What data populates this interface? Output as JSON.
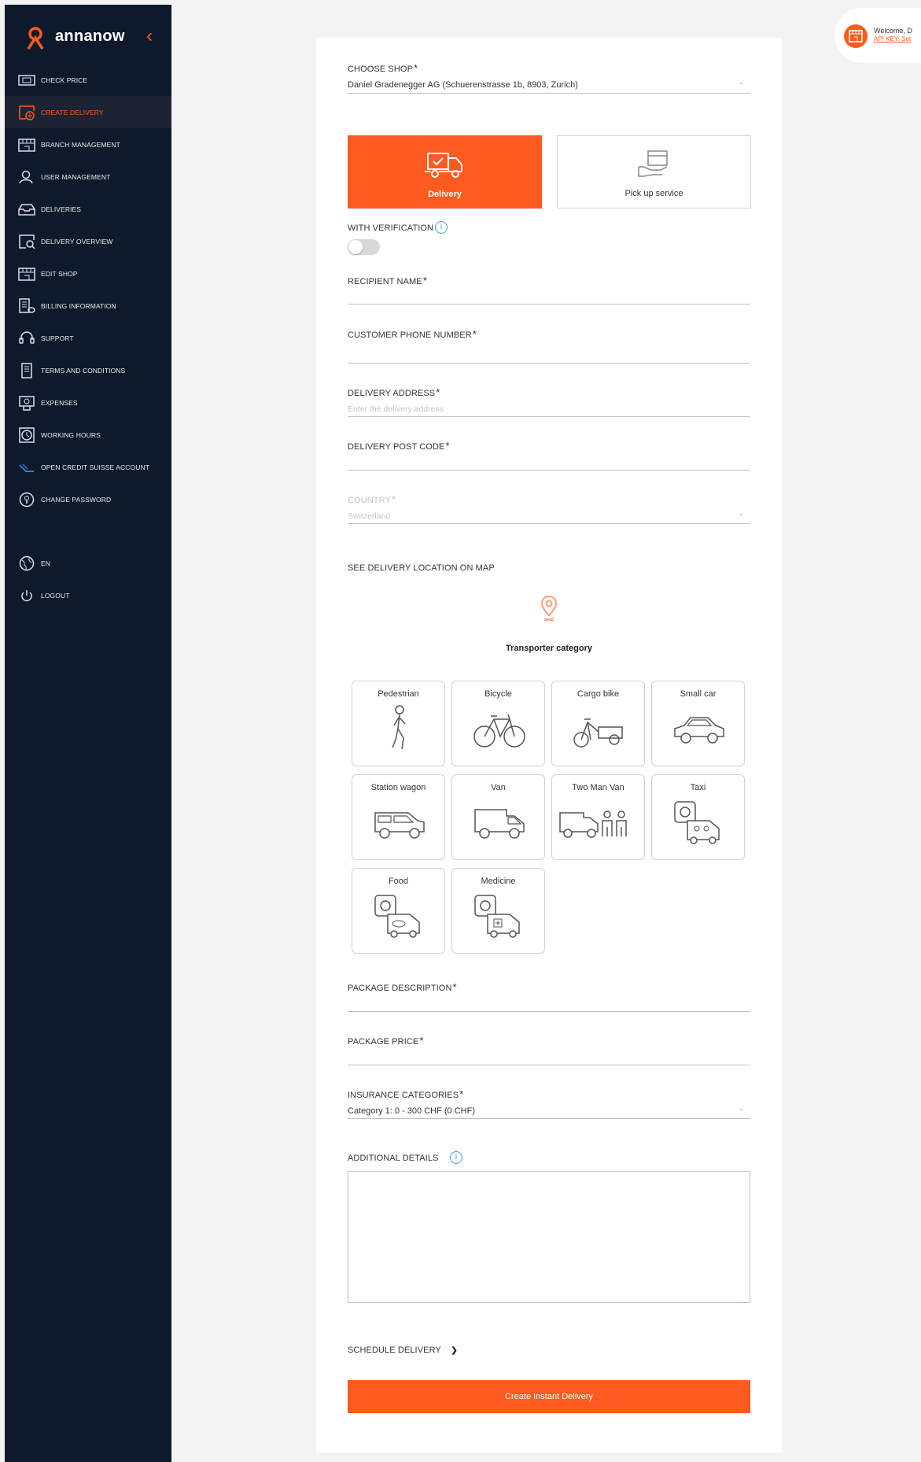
{
  "brand": {
    "name": "annanow"
  },
  "sidebar": {
    "items": [
      {
        "label": "CHECK PRICE",
        "icon": "check-price-icon"
      },
      {
        "label": "CREATE DELIVERY",
        "icon": "create-delivery-icon",
        "active": true
      },
      {
        "label": "BRANCH MANAGEMENT",
        "icon": "branch-icon"
      },
      {
        "label": "USER MANAGEMENT",
        "icon": "user-icon"
      },
      {
        "label": "DELIVERIES",
        "icon": "deliveries-icon"
      },
      {
        "label": "DELIVERY OVERVIEW",
        "icon": "delivery-overview-icon"
      },
      {
        "label": "EDIT SHOP",
        "icon": "shop-icon"
      },
      {
        "label": "BILLING INFORMATION",
        "icon": "billing-icon"
      },
      {
        "label": "SUPPORT",
        "icon": "headset-icon"
      },
      {
        "label": "TERMS AND CONDITIONS",
        "icon": "document-icon"
      },
      {
        "label": "EXPENSES",
        "icon": "expenses-icon"
      },
      {
        "label": "WORKING HOURS",
        "icon": "clock-icon"
      },
      {
        "label": "OPEN CREDIT SUISSE ACCOUNT",
        "icon": "credit-suisse-icon"
      },
      {
        "label": "CHANGE PASSWORD",
        "icon": "lock-icon"
      }
    ],
    "language": "EN",
    "logout": "LOGOUT"
  },
  "welcome": {
    "text": "Welcome, D",
    "api_key": "API KEY: Set"
  },
  "form": {
    "choose_shop": {
      "label": "CHOOSE SHOP",
      "value": "Daniel Gradenegger AG (Schuerenstrasse 1b, 8903, Zurich)"
    },
    "delivery_types": [
      {
        "label": "Delivery",
        "selected": true
      },
      {
        "label": "Pick up service",
        "selected": false
      }
    ],
    "with_verification": "WITH VERIFICATION",
    "recipient_name": {
      "label": "RECIPIENT NAME"
    },
    "customer_phone": {
      "label": "CUSTOMER PHONE NUMBER"
    },
    "delivery_address": {
      "label": "DELIVERY ADDRESS",
      "placeholder": "Enter the delivery address"
    },
    "delivery_post_code": {
      "label": "DELIVERY POST CODE"
    },
    "country": {
      "label": "COUNTRY",
      "value": "Switzerland"
    },
    "see_map": "SEE DELIVERY LOCATION ON MAP",
    "transporter_category": "Transporter category",
    "transporters": [
      {
        "name": "Pedestrian",
        "icon": "pedestrian-icon"
      },
      {
        "name": "Bicycle",
        "icon": "bicycle-icon"
      },
      {
        "name": "Cargo bike",
        "icon": "cargo-bike-icon"
      },
      {
        "name": "Small car",
        "icon": "small-car-icon"
      },
      {
        "name": "Station wagon",
        "icon": "station-wagon-icon"
      },
      {
        "name": "Van",
        "icon": "van-icon"
      },
      {
        "name": "Two Man Van",
        "icon": "two-man-van-icon"
      },
      {
        "name": "Taxi",
        "icon": "taxi-icon"
      },
      {
        "name": "Food",
        "icon": "food-icon"
      },
      {
        "name": "Medicine",
        "icon": "medicine-icon"
      }
    ],
    "package_description": {
      "label": "PACKAGE DESCRIPTION"
    },
    "package_price": {
      "label": "PACKAGE PRICE"
    },
    "insurance": {
      "label": "INSURANCE CATEGORIES",
      "value": "Category 1: 0 - 300 CHF (0 CHF)"
    },
    "additional_details": "ADDITIONAL DETAILS",
    "schedule_delivery": "SCHEDULE DELIVERY",
    "submit": "Create Instant Delivery"
  },
  "colors": {
    "accent": "#ff5a1f",
    "sidebar": "#0e1a2b",
    "info": "#3aa0e0"
  }
}
